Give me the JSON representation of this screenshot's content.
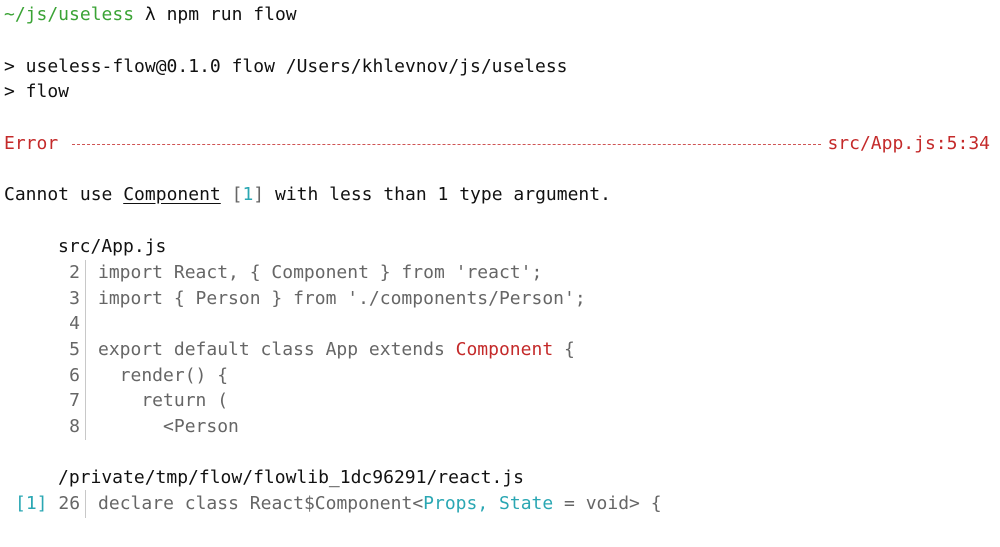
{
  "terminal": {
    "prompt_path": "~/js/useless",
    "prompt_symbol": "λ",
    "command": "npm run flow",
    "npm_output": [
      "> useless-flow@0.1.0 flow /Users/khlevnov/js/useless",
      "> flow"
    ],
    "error": {
      "label": "Error",
      "location": "src/App.js:5:34",
      "message_before": "Cannot use ",
      "message_ident": "Component",
      "message_ref_open": " [",
      "message_ref_num": "1",
      "message_ref_close": "]",
      "message_after": " with less than 1 type argument."
    },
    "source_file": {
      "path": "src/App.js",
      "lines": [
        {
          "num": "2",
          "text": "import React, { Component } from 'react';"
        },
        {
          "num": "3",
          "text": "import { Person } from './components/Person';"
        },
        {
          "num": "4",
          "text": ""
        },
        {
          "num": "5",
          "text_before": "export default class App extends ",
          "highlight": "Component",
          "text_after": " {"
        },
        {
          "num": "6",
          "text": "  render() {"
        },
        {
          "num": "7",
          "text": "    return ("
        },
        {
          "num": "8",
          "text": "      <Person"
        }
      ]
    },
    "lib_file": {
      "path": "/private/tmp/flow/flowlib_1dc96291/react.js",
      "ref": "[1]",
      "line_num": "26",
      "text_before": "declare class React$Component<",
      "highlight": "Props, State",
      "text_after": " = void> {"
    }
  },
  "colors": {
    "prompt_path": "#3aa335",
    "error": "#c42a2a",
    "dim": "#666666",
    "cyan": "#2aa7b3",
    "text": "#111111"
  }
}
